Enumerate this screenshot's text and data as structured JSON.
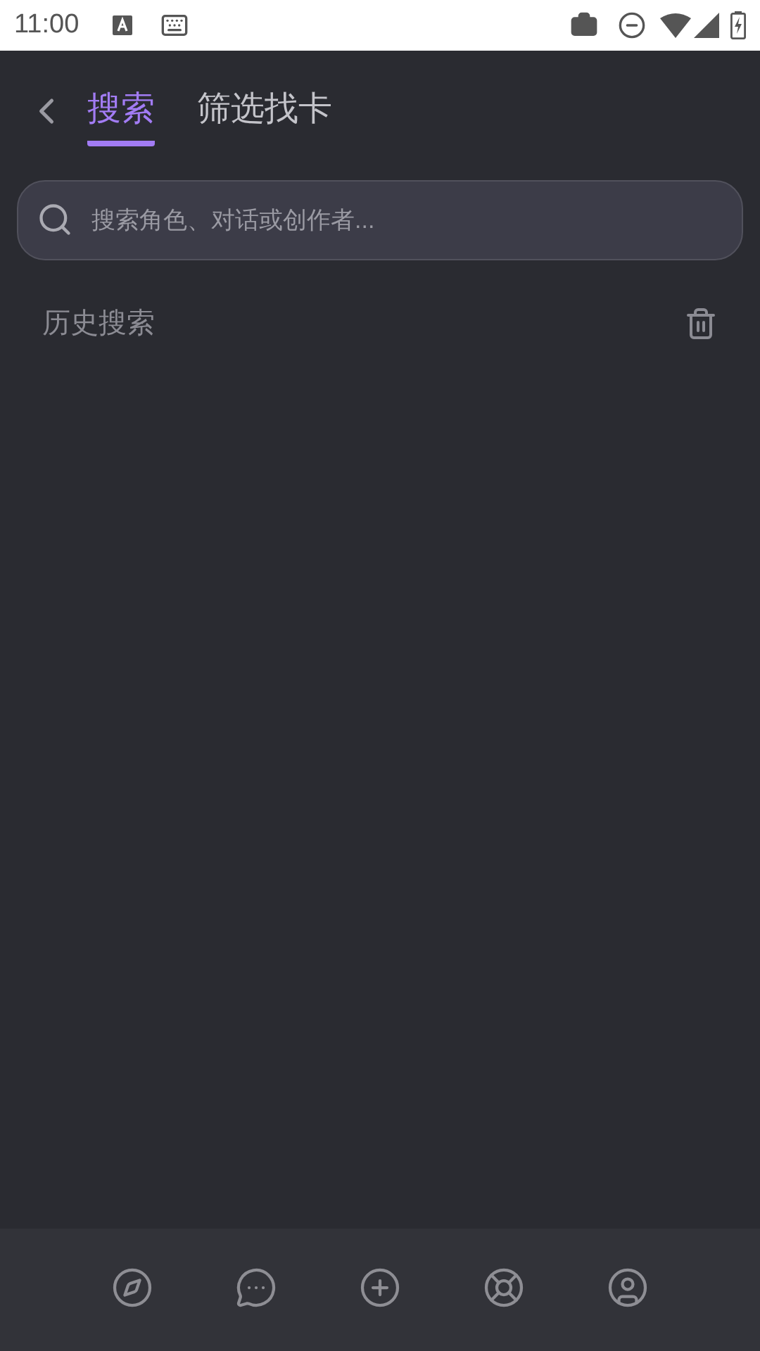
{
  "status_bar": {
    "time": "11:00"
  },
  "tabs": [
    {
      "label": "搜索",
      "selected": true
    },
    {
      "label": "筛选找卡",
      "selected": false
    }
  ],
  "search": {
    "placeholder": "搜索角色、对话或创作者..."
  },
  "history": {
    "title": "历史搜索"
  }
}
